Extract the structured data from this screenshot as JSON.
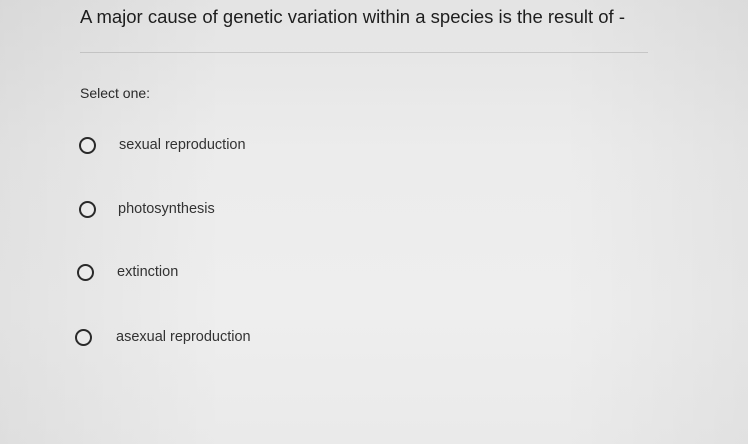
{
  "question": {
    "text": "A major cause of genetic variation within a species is the result of -",
    "prompt": "Select one:"
  },
  "options": [
    {
      "label": "sexual reproduction",
      "selected": false
    },
    {
      "label": "photosynthesis",
      "selected": false
    },
    {
      "label": "extinction",
      "selected": false
    },
    {
      "label": "asexual reproduction",
      "selected": false
    }
  ]
}
